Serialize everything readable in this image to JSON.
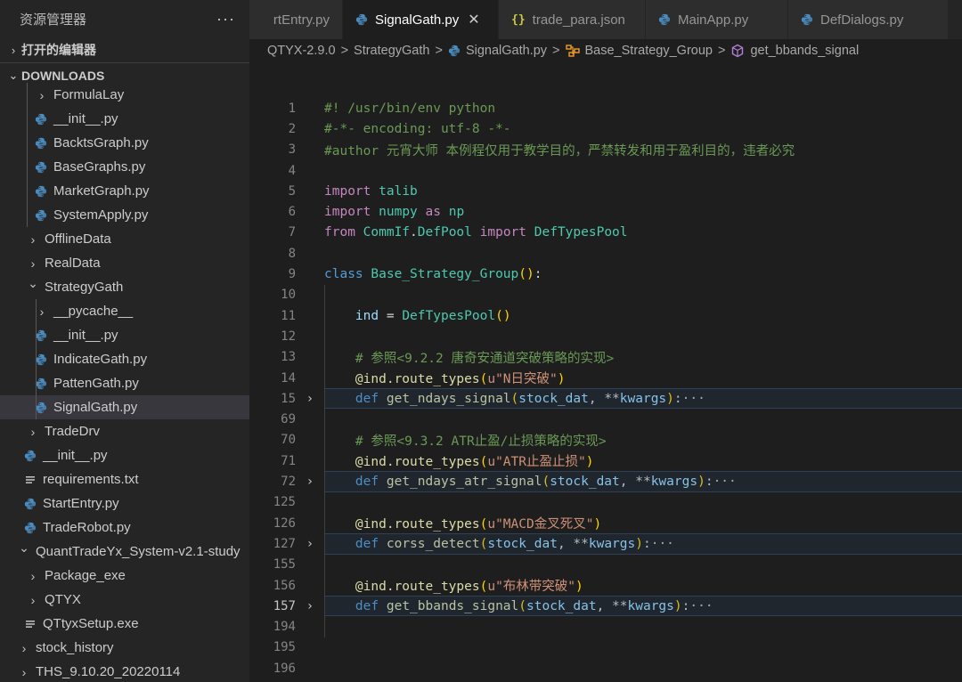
{
  "sidebar": {
    "title": "资源管理器",
    "more": "···",
    "sections": {
      "open_editors": "打开的编辑器",
      "downloads": "DOWNLOADS"
    },
    "tree": [
      {
        "label": "FormulaLay",
        "type": "folder",
        "depth": 2,
        "open": false
      },
      {
        "label": "__init__.py",
        "type": "py",
        "depth": 2
      },
      {
        "label": "BacktsGraph.py",
        "type": "py",
        "depth": 2
      },
      {
        "label": "BaseGraphs.py",
        "type": "py",
        "depth": 2
      },
      {
        "label": "MarketGraph.py",
        "type": "py",
        "depth": 2
      },
      {
        "label": "SystemApply.py",
        "type": "py",
        "depth": 2
      },
      {
        "label": "OfflineData",
        "type": "folder",
        "depth": 1,
        "open": false
      },
      {
        "label": "RealData",
        "type": "folder",
        "depth": 1,
        "open": false
      },
      {
        "label": "StrategyGath",
        "type": "folder",
        "depth": 1,
        "open": true
      },
      {
        "label": "__pycache__",
        "type": "folder",
        "depth": 2,
        "open": false
      },
      {
        "label": "__init__.py",
        "type": "py",
        "depth": 2
      },
      {
        "label": "IndicateGath.py",
        "type": "py",
        "depth": 2
      },
      {
        "label": "PattenGath.py",
        "type": "py",
        "depth": 2
      },
      {
        "label": "SignalGath.py",
        "type": "py",
        "depth": 2,
        "selected": true
      },
      {
        "label": "TradeDrv",
        "type": "folder",
        "depth": 1,
        "open": false
      },
      {
        "label": "__init__.py",
        "type": "py",
        "depth": 1
      },
      {
        "label": "requirements.txt",
        "type": "txt",
        "depth": 1
      },
      {
        "label": "StartEntry.py",
        "type": "py",
        "depth": 1
      },
      {
        "label": "TradeRobot.py",
        "type": "py",
        "depth": 1
      },
      {
        "label": "QuantTradeYx_System-v2.1-study",
        "type": "folder",
        "depth": 0,
        "open": true
      },
      {
        "label": "Package_exe",
        "type": "folder",
        "depth": 1,
        "open": false
      },
      {
        "label": "QTYX",
        "type": "folder",
        "depth": 1,
        "open": false
      },
      {
        "label": "QTtyxSetup.exe",
        "type": "txt",
        "depth": 1
      },
      {
        "label": "stock_history",
        "type": "folder",
        "depth": 0,
        "open": false
      },
      {
        "label": "THS_9.10.20_20220114",
        "type": "folder",
        "depth": 0,
        "open": false
      }
    ]
  },
  "tabs": [
    {
      "label": "rtEntry.py",
      "icon": "python-icon",
      "active": false
    },
    {
      "label": "SignalGath.py",
      "icon": "python-icon",
      "active": true
    },
    {
      "label": "trade_para.json",
      "icon": "json-icon",
      "active": false
    },
    {
      "label": "MainApp.py",
      "icon": "python-icon",
      "active": false
    },
    {
      "label": "DefDialogs.py",
      "icon": "python-icon",
      "active": false
    }
  ],
  "tab_close": "✕",
  "breadcrumb": {
    "items": [
      "QTYX-2.9.0",
      "StrategyGath",
      "SignalGath.py",
      "Base_Strategy_Group",
      "get_bbands_signal"
    ],
    "sep": ">"
  },
  "editor": {
    "current_line": "157",
    "lines": [
      {
        "n": "1",
        "tokens": [
          [
            "c-com",
            "#! /usr/bin/env python"
          ]
        ]
      },
      {
        "n": "2",
        "tokens": [
          [
            "c-com",
            "#-*- encoding: utf-8 -*-"
          ]
        ]
      },
      {
        "n": "3",
        "tokens": [
          [
            "c-com",
            "#author 元宵大师 本例程仅用于教学目的，严禁转发和用于盈利目的，违者必究"
          ]
        ]
      },
      {
        "n": "4",
        "tokens": []
      },
      {
        "n": "5",
        "tokens": [
          [
            "c-kw2",
            "import"
          ],
          [
            "c-op",
            " "
          ],
          [
            "c-cls",
            "talib"
          ]
        ]
      },
      {
        "n": "6",
        "tokens": [
          [
            "c-kw2",
            "import"
          ],
          [
            "c-op",
            " "
          ],
          [
            "c-cls",
            "numpy"
          ],
          [
            "c-op",
            " "
          ],
          [
            "c-kw2",
            "as"
          ],
          [
            "c-op",
            " "
          ],
          [
            "c-cls",
            "np"
          ]
        ]
      },
      {
        "n": "7",
        "tokens": [
          [
            "c-kw2",
            "from"
          ],
          [
            "c-op",
            " "
          ],
          [
            "c-cls",
            "CommIf"
          ],
          [
            "c-op",
            "."
          ],
          [
            "c-cls",
            "DefPool"
          ],
          [
            "c-op",
            " "
          ],
          [
            "c-kw2",
            "import"
          ],
          [
            "c-op",
            " "
          ],
          [
            "c-cls",
            "DefTypesPool"
          ]
        ]
      },
      {
        "n": "8",
        "tokens": []
      },
      {
        "n": "9",
        "tokens": [
          [
            "c-kw",
            "class"
          ],
          [
            "c-op",
            " "
          ],
          [
            "c-cls",
            "Base_Strategy_Group"
          ],
          [
            "c-par",
            "()"
          ],
          [
            "c-op",
            ":"
          ]
        ]
      },
      {
        "n": "10",
        "tokens": []
      },
      {
        "n": "11",
        "tokens": [
          [
            "c-op",
            "    "
          ],
          [
            "c-var",
            "ind"
          ],
          [
            "c-op",
            " = "
          ],
          [
            "c-cls",
            "DefTypesPool"
          ],
          [
            "c-par",
            "()"
          ]
        ]
      },
      {
        "n": "12",
        "tokens": []
      },
      {
        "n": "13",
        "tokens": [
          [
            "c-op",
            "    "
          ],
          [
            "c-com",
            "# 参照<9.2.2 唐奇安通道突破策略的实现>"
          ]
        ]
      },
      {
        "n": "14",
        "tokens": [
          [
            "c-op",
            "    "
          ],
          [
            "c-fn",
            "@ind.route_types"
          ],
          [
            "c-par",
            "("
          ],
          [
            "c-str",
            "u\"N日突破\""
          ],
          [
            "c-par",
            ")"
          ]
        ]
      },
      {
        "n": "15",
        "fold": true,
        "hl": true,
        "tokens": [
          [
            "c-op",
            "    "
          ],
          [
            "c-kw",
            "def"
          ],
          [
            "c-op",
            " "
          ],
          [
            "c-fn",
            "get_ndays_signal"
          ],
          [
            "c-par",
            "("
          ],
          [
            "c-var",
            "stock_dat"
          ],
          [
            "c-op",
            ", **"
          ],
          [
            "c-var",
            "kwargs"
          ],
          [
            "c-par",
            ")"
          ],
          [
            "c-op",
            ":"
          ],
          [
            "c-dots",
            "···"
          ]
        ]
      },
      {
        "n": "69",
        "tokens": []
      },
      {
        "n": "70",
        "tokens": [
          [
            "c-op",
            "    "
          ],
          [
            "c-com",
            "# 参照<9.3.2 ATR止盈/止损策略的实现>"
          ]
        ]
      },
      {
        "n": "71",
        "tokens": [
          [
            "c-op",
            "    "
          ],
          [
            "c-fn",
            "@ind.route_types"
          ],
          [
            "c-par",
            "("
          ],
          [
            "c-str",
            "u\"ATR止盈止损\""
          ],
          [
            "c-par",
            ")"
          ]
        ]
      },
      {
        "n": "72",
        "fold": true,
        "hl": true,
        "tokens": [
          [
            "c-op",
            "    "
          ],
          [
            "c-kw",
            "def"
          ],
          [
            "c-op",
            " "
          ],
          [
            "c-fn",
            "get_ndays_atr_signal"
          ],
          [
            "c-par",
            "("
          ],
          [
            "c-var",
            "stock_dat"
          ],
          [
            "c-op",
            ", **"
          ],
          [
            "c-var",
            "kwargs"
          ],
          [
            "c-par",
            ")"
          ],
          [
            "c-op",
            ":"
          ],
          [
            "c-dots",
            "···"
          ]
        ]
      },
      {
        "n": "125",
        "tokens": []
      },
      {
        "n": "126",
        "tokens": [
          [
            "c-op",
            "    "
          ],
          [
            "c-fn",
            "@ind.route_types"
          ],
          [
            "c-par",
            "("
          ],
          [
            "c-str",
            "u\"MACD金叉死叉\""
          ],
          [
            "c-par",
            ")"
          ]
        ]
      },
      {
        "n": "127",
        "fold": true,
        "hl": true,
        "tokens": [
          [
            "c-op",
            "    "
          ],
          [
            "c-kw",
            "def"
          ],
          [
            "c-op",
            " "
          ],
          [
            "c-fn",
            "corss_detect"
          ],
          [
            "c-par",
            "("
          ],
          [
            "c-var",
            "stock_dat"
          ],
          [
            "c-op",
            ", **"
          ],
          [
            "c-var",
            "kwargs"
          ],
          [
            "c-par",
            ")"
          ],
          [
            "c-op",
            ":"
          ],
          [
            "c-dots",
            "···"
          ]
        ]
      },
      {
        "n": "155",
        "tokens": []
      },
      {
        "n": "156",
        "tokens": [
          [
            "c-op",
            "    "
          ],
          [
            "c-fn",
            "@ind.route_types"
          ],
          [
            "c-par",
            "("
          ],
          [
            "c-str",
            "u\"布林带突破\""
          ],
          [
            "c-par",
            ")"
          ]
        ]
      },
      {
        "n": "157",
        "fold": true,
        "hl": true,
        "tokens": [
          [
            "c-op",
            "    "
          ],
          [
            "c-kw",
            "def"
          ],
          [
            "c-op",
            " "
          ],
          [
            "c-fn",
            "get_bbands_signal"
          ],
          [
            "c-par",
            "("
          ],
          [
            "c-var",
            "stock_dat"
          ],
          [
            "c-op",
            ", **"
          ],
          [
            "c-var",
            "kwargs"
          ],
          [
            "c-par",
            ")"
          ],
          [
            "c-op",
            ":"
          ],
          [
            "c-dots",
            "···"
          ]
        ]
      },
      {
        "n": "194",
        "tokens": []
      },
      {
        "n": "195",
        "tokens": []
      },
      {
        "n": "196",
        "tokens": []
      }
    ]
  }
}
